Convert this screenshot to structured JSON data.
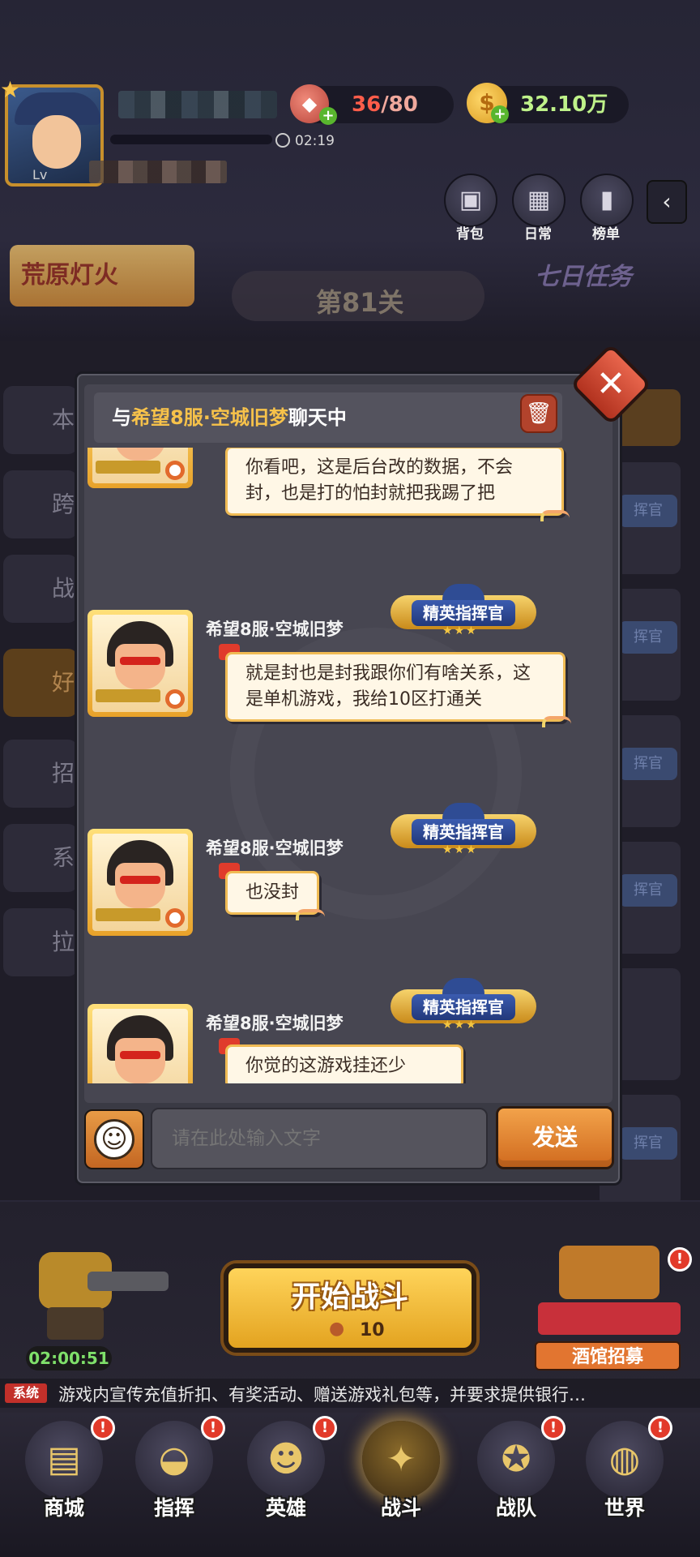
{
  "hud": {
    "level_prefix": "Lv",
    "timer": "02:19",
    "meat_current": "36",
    "meat_max": "/80",
    "coins": "32.10万",
    "plus": "+",
    "buttons": [
      {
        "label": "背包",
        "icon": "backpack-icon"
      },
      {
        "label": "日常",
        "icon": "daily-box-icon"
      },
      {
        "label": "榜单",
        "icon": "ranking-icon"
      }
    ],
    "banner_left": "荒原灯火",
    "banner_mid": "第81关",
    "banner_right": "七日任务"
  },
  "side_tabs": [
    "本",
    "跨",
    "战",
    "好",
    "招",
    "系",
    "拉"
  ],
  "right_badge": "挥官",
  "chat": {
    "header_prefix": "与",
    "header_target": "希望8服·空城旧梦",
    "header_suffix": "聊天中",
    "messages": [
      {
        "sender": "",
        "text": "你看吧，这是后台改的数据，不会封，也是打的怕封就把我踢了把"
      },
      {
        "sender": "希望8服·空城旧梦",
        "title": "精英指挥官",
        "text": "就是封也是封我跟你们有啥关系，这是单机游戏，我给10区打通关"
      },
      {
        "sender": "希望8服·空城旧梦",
        "title": "精英指挥官",
        "text": "也没封"
      },
      {
        "sender": "希望8服·空城旧梦",
        "title": "精英指挥官",
        "text": "你觉的这游戏挂还少"
      }
    ],
    "input_placeholder": "请在此处输入文字",
    "send_label": "发送"
  },
  "battle": {
    "mech_timer": "02:00:51",
    "start_label": "开始战斗",
    "start_cost": "10",
    "tavern_label": "酒馆招募",
    "alert": "!"
  },
  "news": {
    "tag": "系统",
    "text": "游戏内宣传充值折扣、有奖活动、赠送游戏礼包等，并要求提供银行…"
  },
  "nav": [
    {
      "label": "商城",
      "icon": "shop-icon",
      "badge": true
    },
    {
      "label": "指挥",
      "icon": "commander-hat-icon",
      "badge": true
    },
    {
      "label": "英雄",
      "icon": "hero-icon",
      "badge": true
    },
    {
      "label": "战斗",
      "icon": "battle-gun-icon",
      "badge": false,
      "active": true
    },
    {
      "label": "战队",
      "icon": "team-emblem-icon",
      "badge": true
    },
    {
      "label": "世界",
      "icon": "globe-icon",
      "badge": true
    }
  ]
}
